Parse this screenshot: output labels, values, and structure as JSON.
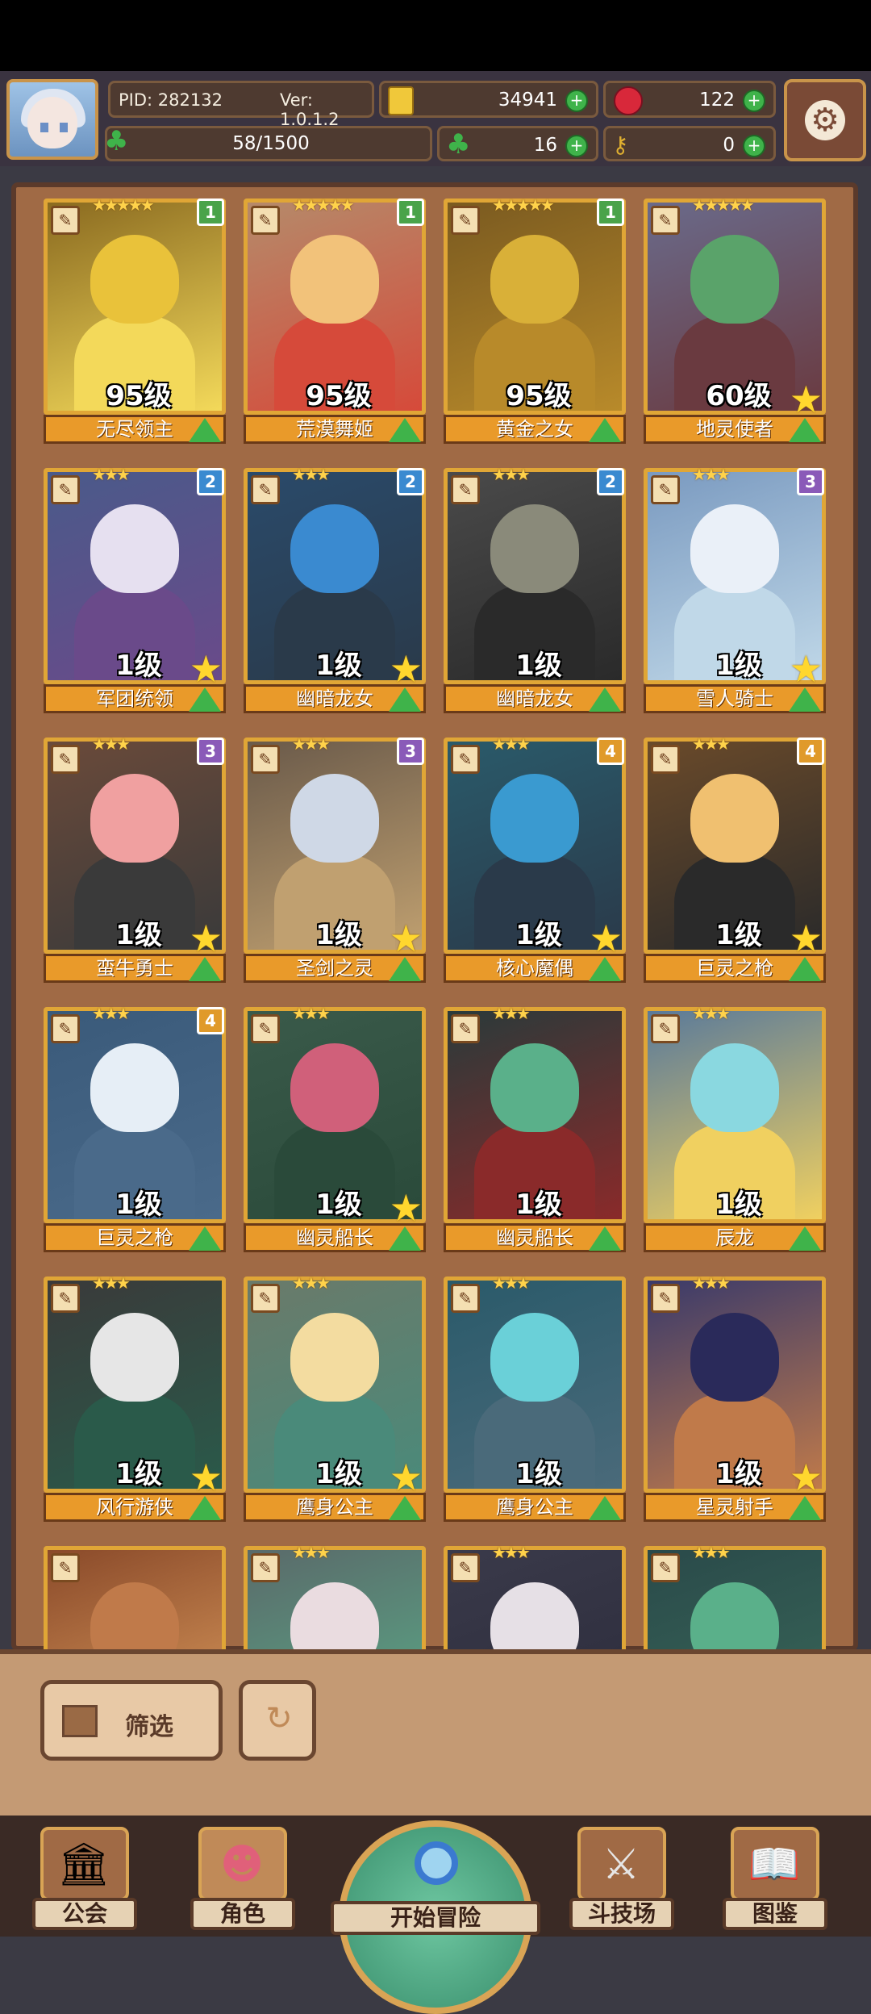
{
  "header": {
    "pid": "PID: 282132",
    "version": "Ver: 1.0.1.2",
    "gold": "34941",
    "gems": "122",
    "exp": "58/1500",
    "clover": "16",
    "keys": "0"
  },
  "cards": [
    {
      "name": "无尽领主",
      "level": "95级",
      "stars": "★★★★★",
      "tier": "1",
      "tier_color": "#4aa34a",
      "palette": [
        "#8a6a20",
        "#e9c23a",
        "#f3d95a"
      ],
      "fav": false
    },
    {
      "name": "荒漠舞姬",
      "level": "95级",
      "stars": "★★★★★",
      "tier": "1",
      "tier_color": "#4aa34a",
      "palette": [
        "#b58a6a",
        "#f2c27a",
        "#d64a3a"
      ],
      "fav": false
    },
    {
      "name": "黄金之女",
      "level": "95级",
      "stars": "★★★★★",
      "tier": "1",
      "tier_color": "#4aa34a",
      "palette": [
        "#7a5a20",
        "#d9b038",
        "#b88a2a"
      ],
      "fav": false
    },
    {
      "name": "地灵使者",
      "level": "60级",
      "stars": "★★★★★",
      "tier": "",
      "tier_color": "",
      "palette": [
        "#6a6a8a",
        "#5aa36a",
        "#6a3a40"
      ],
      "fav": true
    },
    {
      "name": "军团统领",
      "level": "1级",
      "stars": "★★★",
      "tier": "2",
      "tier_color": "#3a8ad0",
      "palette": [
        "#4a5a8a",
        "#e6e0f0",
        "#6a4a8a"
      ],
      "fav": true
    },
    {
      "name": "幽暗龙女",
      "level": "1级",
      "stars": "★★★",
      "tier": "2",
      "tier_color": "#3a8ad0",
      "palette": [
        "#2a4a6a",
        "#3a8ad0",
        "#2a3a4a"
      ],
      "fav": true
    },
    {
      "name": "幽暗龙女",
      "level": "1级",
      "stars": "★★★",
      "tier": "2",
      "tier_color": "#3a8ad0",
      "palette": [
        "#4a4a4a",
        "#8a8a7a",
        "#2a2a2a"
      ],
      "fav": false
    },
    {
      "name": "雪人骑士",
      "level": "1级",
      "stars": "★★★",
      "tier": "3",
      "tier_color": "#8a5ab8",
      "palette": [
        "#7a9ac0",
        "#eaf0f8",
        "#c0d8e8"
      ],
      "fav": true
    },
    {
      "name": "蛮牛勇士",
      "level": "1级",
      "stars": "★★★",
      "tier": "3",
      "tier_color": "#8a5ab8",
      "palette": [
        "#6a4a3a",
        "#f0a0a0",
        "#3a3a3a"
      ],
      "fav": true
    },
    {
      "name": "圣剑之灵",
      "level": "1级",
      "stars": "★★★",
      "tier": "3",
      "tier_color": "#8a5ab8",
      "palette": [
        "#6a5a4a",
        "#cfd8e6",
        "#c0a070"
      ],
      "fav": true
    },
    {
      "name": "核心魔偶",
      "level": "1级",
      "stars": "★★★",
      "tier": "4",
      "tier_color": "#e09a2a",
      "palette": [
        "#2a5a6a",
        "#3a9ad0",
        "#2a3a4a"
      ],
      "fav": true
    },
    {
      "name": "巨灵之枪",
      "level": "1级",
      "stars": "★★★",
      "tier": "4",
      "tier_color": "#e09a2a",
      "palette": [
        "#6a4a2a",
        "#f0c070",
        "#2a2a2a"
      ],
      "fav": true
    },
    {
      "name": "巨灵之枪",
      "level": "1级",
      "stars": "★★★",
      "tier": "4",
      "tier_color": "#e09a2a",
      "palette": [
        "#3a5a7a",
        "#e6eef6",
        "#4a6a8a"
      ],
      "fav": false
    },
    {
      "name": "幽灵船长",
      "level": "1级",
      "stars": "★★★",
      "tier": "",
      "tier_color": "",
      "palette": [
        "#3a5a4a",
        "#d0607a",
        "#2a4a3a"
      ],
      "fav": true
    },
    {
      "name": "幽灵船长",
      "level": "1级",
      "stars": "★★★",
      "tier": "",
      "tier_color": "",
      "palette": [
        "#2a3a3a",
        "#5ab08a",
        "#8a2a2a"
      ],
      "fav": false
    },
    {
      "name": "辰龙",
      "level": "1级",
      "stars": "★★★",
      "tier": "",
      "tier_color": "",
      "palette": [
        "#5a7a9a",
        "#8ad8e0",
        "#f0d060"
      ],
      "fav": false
    },
    {
      "name": "风行游侠",
      "level": "1级",
      "stars": "★★★",
      "tier": "",
      "tier_color": "",
      "palette": [
        "#3a3a3a",
        "#e6e6e6",
        "#2a5a4a"
      ],
      "fav": true
    },
    {
      "name": "鹰身公主",
      "level": "1级",
      "stars": "★★★",
      "tier": "",
      "tier_color": "",
      "palette": [
        "#6a7a6a",
        "#f3dca0",
        "#4a8a7a"
      ],
      "fav": true
    },
    {
      "name": "鹰身公主",
      "level": "1级",
      "stars": "★★★",
      "tier": "",
      "tier_color": "",
      "palette": [
        "#2a5a6a",
        "#6ad0d8",
        "#4a6a7a"
      ],
      "fav": false
    },
    {
      "name": "星灵射手",
      "level": "1级",
      "stars": "★★★",
      "tier": "",
      "tier_color": "",
      "palette": [
        "#3a3a6a",
        "#2a2a5a",
        "#c07a4a"
      ],
      "fav": true
    },
    {
      "name": "",
      "level": "",
      "stars": "",
      "tier": "",
      "tier_color": "",
      "palette": [
        "#8a4a2a",
        "#c07a4a",
        "#e0a060"
      ],
      "fav": false
    },
    {
      "name": "",
      "level": "",
      "stars": "★★★",
      "tier": "",
      "tier_color": "",
      "palette": [
        "#5a6a6a",
        "#eadce0",
        "#5ab08a"
      ],
      "fav": false
    },
    {
      "name": "",
      "level": "",
      "stars": "★★★",
      "tier": "",
      "tier_color": "",
      "palette": [
        "#3a3a4a",
        "#e6e0e6",
        "#2a2a3a"
      ],
      "fav": false
    },
    {
      "name": "",
      "level": "",
      "stars": "★★★",
      "tier": "",
      "tier_color": "",
      "palette": [
        "#2a4a4a",
        "#5ab08a",
        "#3a6a5a"
      ],
      "fav": false
    }
  ],
  "bottom": {
    "filter_label": "筛选"
  },
  "nav": [
    {
      "label": "公会",
      "icon": "guild-icon"
    },
    {
      "label": "角色",
      "icon": "character-icon"
    },
    {
      "label": "开始冒险",
      "icon": "adventure-icon"
    },
    {
      "label": "斗技场",
      "icon": "arena-icon"
    },
    {
      "label": "图鉴",
      "icon": "codex-icon"
    }
  ]
}
